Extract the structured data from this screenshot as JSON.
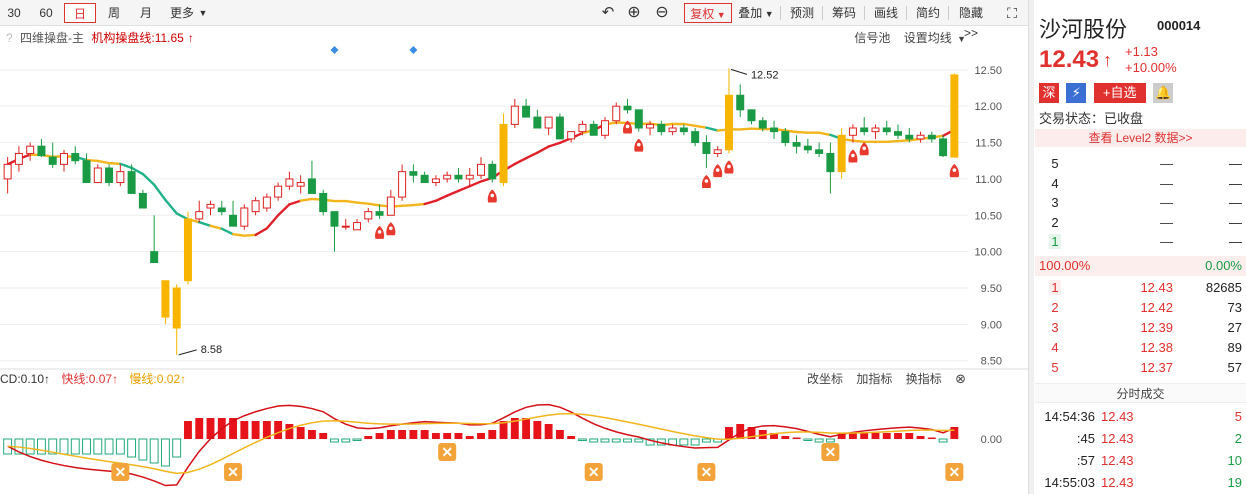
{
  "toolbar": {
    "periods": [
      "30",
      "60",
      "日",
      "周",
      "月",
      "更多"
    ],
    "actions": [
      "复权",
      "叠加",
      "预测",
      "筹码",
      "画线",
      "简约",
      "隐藏>>"
    ]
  },
  "chart_main": {
    "indicator_name": "四维操盘-主",
    "line_label": "机构操盘线:11.65",
    "right_links": [
      "信号池",
      "设置均线"
    ],
    "high_label": "12.52",
    "low_label": "8.58",
    "y_ticks": [
      "12.50",
      "12.00",
      "11.50",
      "11.00",
      "10.50",
      "10.00",
      "9.50",
      "9.00",
      "8.50"
    ]
  },
  "chart_macd": {
    "prefix": "CD:0.10",
    "fast": "快线:0.07",
    "slow": "慢线:0.02",
    "right_links": [
      "改坐标",
      "加指标",
      "换指标"
    ],
    "zero_tick": "0.00"
  },
  "chart_data": {
    "type": "candlestick",
    "ylim": [
      8.4,
      12.8
    ],
    "ohlc": [
      [
        11.0,
        11.3,
        10.8,
        11.2
      ],
      [
        11.2,
        11.45,
        11.1,
        11.35
      ],
      [
        11.35,
        11.5,
        11.25,
        11.45
      ],
      [
        11.45,
        11.55,
        11.3,
        11.32
      ],
      [
        11.3,
        11.5,
        11.15,
        11.2
      ],
      [
        11.2,
        11.4,
        11.1,
        11.35
      ],
      [
        11.35,
        11.45,
        11.2,
        11.25
      ],
      [
        11.25,
        11.35,
        10.95,
        10.95
      ],
      [
        10.95,
        11.2,
        10.95,
        11.15
      ],
      [
        11.15,
        11.2,
        10.9,
        10.95
      ],
      [
        10.95,
        11.2,
        10.9,
        11.1
      ],
      [
        11.1,
        11.2,
        10.8,
        10.8
      ],
      [
        10.8,
        10.85,
        10.6,
        10.6
      ],
      [
        10.0,
        10.5,
        9.85,
        9.85
      ],
      [
        9.6,
        9.6,
        9.0,
        9.1
      ],
      [
        8.95,
        9.55,
        8.58,
        9.5
      ],
      [
        9.6,
        10.55,
        9.55,
        10.45
      ],
      [
        10.45,
        10.7,
        10.4,
        10.55
      ],
      [
        10.6,
        10.7,
        10.5,
        10.65
      ],
      [
        10.6,
        10.7,
        10.5,
        10.55
      ],
      [
        10.5,
        10.7,
        10.35,
        10.35
      ],
      [
        10.35,
        10.65,
        10.3,
        10.6
      ],
      [
        10.55,
        10.75,
        10.5,
        10.7
      ],
      [
        10.6,
        10.8,
        10.55,
        10.75
      ],
      [
        10.75,
        10.95,
        10.7,
        10.9
      ],
      [
        10.9,
        11.1,
        10.85,
        11.0
      ],
      [
        10.9,
        11.05,
        10.8,
        10.95
      ],
      [
        11.0,
        11.25,
        10.8,
        10.8
      ],
      [
        10.8,
        10.85,
        10.5,
        10.55
      ],
      [
        10.55,
        10.55,
        10.0,
        10.35
      ],
      [
        10.35,
        10.45,
        10.3,
        10.35
      ],
      [
        10.3,
        10.45,
        10.3,
        10.4
      ],
      [
        10.45,
        10.6,
        10.4,
        10.55
      ],
      [
        10.55,
        10.65,
        10.45,
        10.5
      ],
      [
        10.5,
        10.85,
        10.5,
        10.75
      ],
      [
        10.75,
        11.2,
        10.7,
        11.1
      ],
      [
        11.1,
        11.2,
        10.95,
        11.05
      ],
      [
        11.05,
        11.1,
        10.95,
        10.95
      ],
      [
        10.95,
        11.05,
        10.9,
        11.0
      ],
      [
        11.0,
        11.1,
        10.95,
        11.05
      ],
      [
        11.05,
        11.15,
        10.95,
        11.0
      ],
      [
        11.0,
        11.15,
        10.9,
        11.05
      ],
      [
        11.05,
        11.3,
        11.0,
        11.2
      ],
      [
        11.2,
        11.25,
        10.95,
        11.0
      ],
      [
        10.95,
        11.9,
        10.9,
        11.75
      ],
      [
        11.75,
        12.1,
        11.7,
        12.0
      ],
      [
        12.0,
        12.1,
        11.85,
        11.85
      ],
      [
        11.85,
        11.95,
        11.7,
        11.7
      ],
      [
        11.7,
        11.85,
        11.6,
        11.85
      ],
      [
        11.85,
        11.9,
        11.55,
        11.55
      ],
      [
        11.55,
        11.65,
        11.5,
        11.65
      ],
      [
        11.65,
        11.8,
        11.6,
        11.75
      ],
      [
        11.75,
        11.8,
        11.6,
        11.6
      ],
      [
        11.6,
        11.85,
        11.55,
        11.8
      ],
      [
        11.8,
        12.05,
        11.75,
        12.0
      ],
      [
        12.0,
        12.1,
        11.9,
        11.95
      ],
      [
        11.95,
        11.95,
        11.65,
        11.7
      ],
      [
        11.7,
        11.8,
        11.6,
        11.75
      ],
      [
        11.75,
        11.8,
        11.6,
        11.65
      ],
      [
        11.65,
        11.75,
        11.6,
        11.7
      ],
      [
        11.7,
        11.75,
        11.6,
        11.65
      ],
      [
        11.65,
        11.7,
        11.45,
        11.5
      ],
      [
        11.5,
        11.6,
        11.15,
        11.35
      ],
      [
        11.35,
        11.45,
        11.3,
        11.4
      ],
      [
        11.4,
        12.52,
        11.35,
        12.15
      ],
      [
        12.15,
        12.3,
        11.85,
        11.95
      ],
      [
        11.95,
        11.95,
        11.75,
        11.8
      ],
      [
        11.8,
        11.85,
        11.65,
        11.7
      ],
      [
        11.7,
        11.8,
        11.55,
        11.65
      ],
      [
        11.65,
        11.7,
        11.45,
        11.5
      ],
      [
        11.5,
        11.6,
        11.35,
        11.45
      ],
      [
        11.45,
        11.55,
        11.35,
        11.4
      ],
      [
        11.4,
        11.5,
        11.3,
        11.35
      ],
      [
        11.35,
        11.5,
        10.8,
        11.1
      ],
      [
        11.1,
        11.7,
        11.0,
        11.6
      ],
      [
        11.6,
        11.75,
        11.5,
        11.7
      ],
      [
        11.7,
        11.85,
        11.6,
        11.65
      ],
      [
        11.65,
        11.75,
        11.55,
        11.7
      ],
      [
        11.7,
        11.8,
        11.6,
        11.65
      ],
      [
        11.65,
        11.75,
        11.55,
        11.6
      ],
      [
        11.6,
        11.7,
        11.5,
        11.55
      ],
      [
        11.55,
        11.65,
        11.5,
        11.6
      ],
      [
        11.6,
        11.65,
        11.5,
        11.55
      ],
      [
        11.55,
        11.6,
        11.3,
        11.32
      ],
      [
        11.3,
        12.45,
        11.3,
        12.43
      ]
    ],
    "macd_hist": [
      -0.05,
      -0.05,
      -0.05,
      -0.05,
      -0.05,
      -0.05,
      -0.05,
      -0.05,
      -0.05,
      -0.05,
      -0.05,
      -0.06,
      -0.07,
      -0.08,
      -0.09,
      -0.06,
      0.06,
      0.07,
      0.07,
      0.07,
      0.07,
      0.06,
      0.06,
      0.06,
      0.06,
      0.05,
      0.04,
      0.03,
      0.02,
      -0.01,
      -0.01,
      -0.005,
      0.01,
      0.02,
      0.03,
      0.03,
      0.03,
      0.03,
      0.02,
      0.02,
      0.02,
      0.01,
      0.02,
      0.03,
      0.06,
      0.07,
      0.07,
      0.06,
      0.05,
      0.03,
      0.01,
      -0.005,
      -0.01,
      -0.01,
      -0.01,
      -0.01,
      -0.01,
      -0.02,
      -0.02,
      -0.02,
      -0.02,
      -0.02,
      -0.01,
      -0.01,
      0.04,
      0.05,
      0.04,
      0.03,
      0.02,
      0.01,
      0.005,
      -0.005,
      -0.01,
      -0.01,
      0.02,
      0.02,
      0.02,
      0.02,
      0.02,
      0.02,
      0.02,
      0.01,
      0.005,
      -0.01,
      0.04
    ]
  },
  "panel": {
    "name": "沙河股份",
    "code": "000014",
    "price": "12.43",
    "arrow": "↑",
    "change": "+1.13",
    "change_pct": "+10.00%",
    "badge_market": "深",
    "badge_add": "+自选",
    "trade_status": "交易状态：已收盘",
    "level2": "查看 Level2 数据>>",
    "asks": [
      {
        "lv": "5",
        "price": "—",
        "vol": "—"
      },
      {
        "lv": "4",
        "price": "—",
        "vol": "—"
      },
      {
        "lv": "3",
        "price": "—",
        "vol": "—"
      },
      {
        "lv": "2",
        "price": "—",
        "vol": "—"
      },
      {
        "lv": "1",
        "price": "—",
        "vol": "—"
      }
    ],
    "ratio_left": "100.00%",
    "ratio_right": "0.00%",
    "bids": [
      {
        "lv": "1",
        "price": "12.43",
        "vol": "82685"
      },
      {
        "lv": "2",
        "price": "12.42",
        "vol": "73"
      },
      {
        "lv": "3",
        "price": "12.39",
        "vol": "27"
      },
      {
        "lv": "4",
        "price": "12.38",
        "vol": "89"
      },
      {
        "lv": "5",
        "price": "12.37",
        "vol": "57"
      }
    ],
    "ticks_title": "分时成交",
    "ticks": [
      {
        "t": "14:54:36",
        "p": "12.43",
        "v": "5"
      },
      {
        "t": ":45",
        "p": "12.43",
        "v": "2"
      },
      {
        "t": ":57",
        "p": "12.43",
        "v": "10"
      },
      {
        "t": "14:55:03",
        "p": "12.43",
        "v": "19"
      }
    ]
  }
}
